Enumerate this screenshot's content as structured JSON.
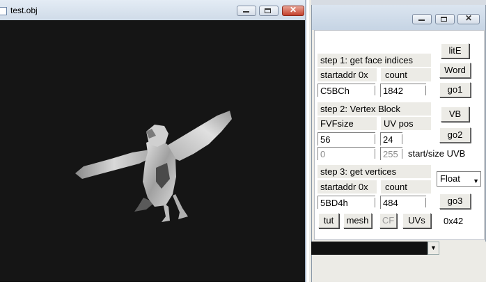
{
  "viewer": {
    "title": "test.obj",
    "controls": {
      "minimize_icon": "minimize-icon",
      "maximize_icon": "maximize-icon",
      "close_icon": "close-icon",
      "close_glyph": "✕"
    }
  },
  "colors": {
    "canvas_bg": "#151515",
    "model": "#c8c8c8",
    "window_close": "#c4412d"
  },
  "tool": {
    "controls": {
      "minimize_icon": "minimize-icon",
      "maximize_icon": "maximize-icon",
      "close_icon": "close-icon",
      "close_glyph": "✕"
    },
    "step1": {
      "heading": "step 1: get face indices",
      "startaddr_label": "startaddr 0x",
      "count_label": "count",
      "startaddr_value": "C5BCh",
      "count_value": "1842"
    },
    "step2": {
      "heading": "step 2: Vertex Block",
      "fvfsize_label": "FVFsize",
      "uvpos_label": "UV pos",
      "fvfsize_value": "56",
      "uvpos_value": "24",
      "start_value": "0",
      "size_value": "255",
      "startsize_label": "start/size UVB"
    },
    "step3": {
      "heading": "step 3: get vertices",
      "startaddr_label": "startaddr 0x",
      "count_label": "count",
      "startaddr_value": "5BD4h",
      "count_value": "484"
    },
    "buttons": {
      "lite": "litE",
      "word": "Word",
      "go1": "go1",
      "vb": "VB",
      "go2": "go2",
      "go3": "go3",
      "tut": "tut",
      "mesh": "mesh",
      "cf": "CF",
      "uvs": "UVs"
    },
    "format_select": "Float",
    "hex_readout": "0x42"
  }
}
